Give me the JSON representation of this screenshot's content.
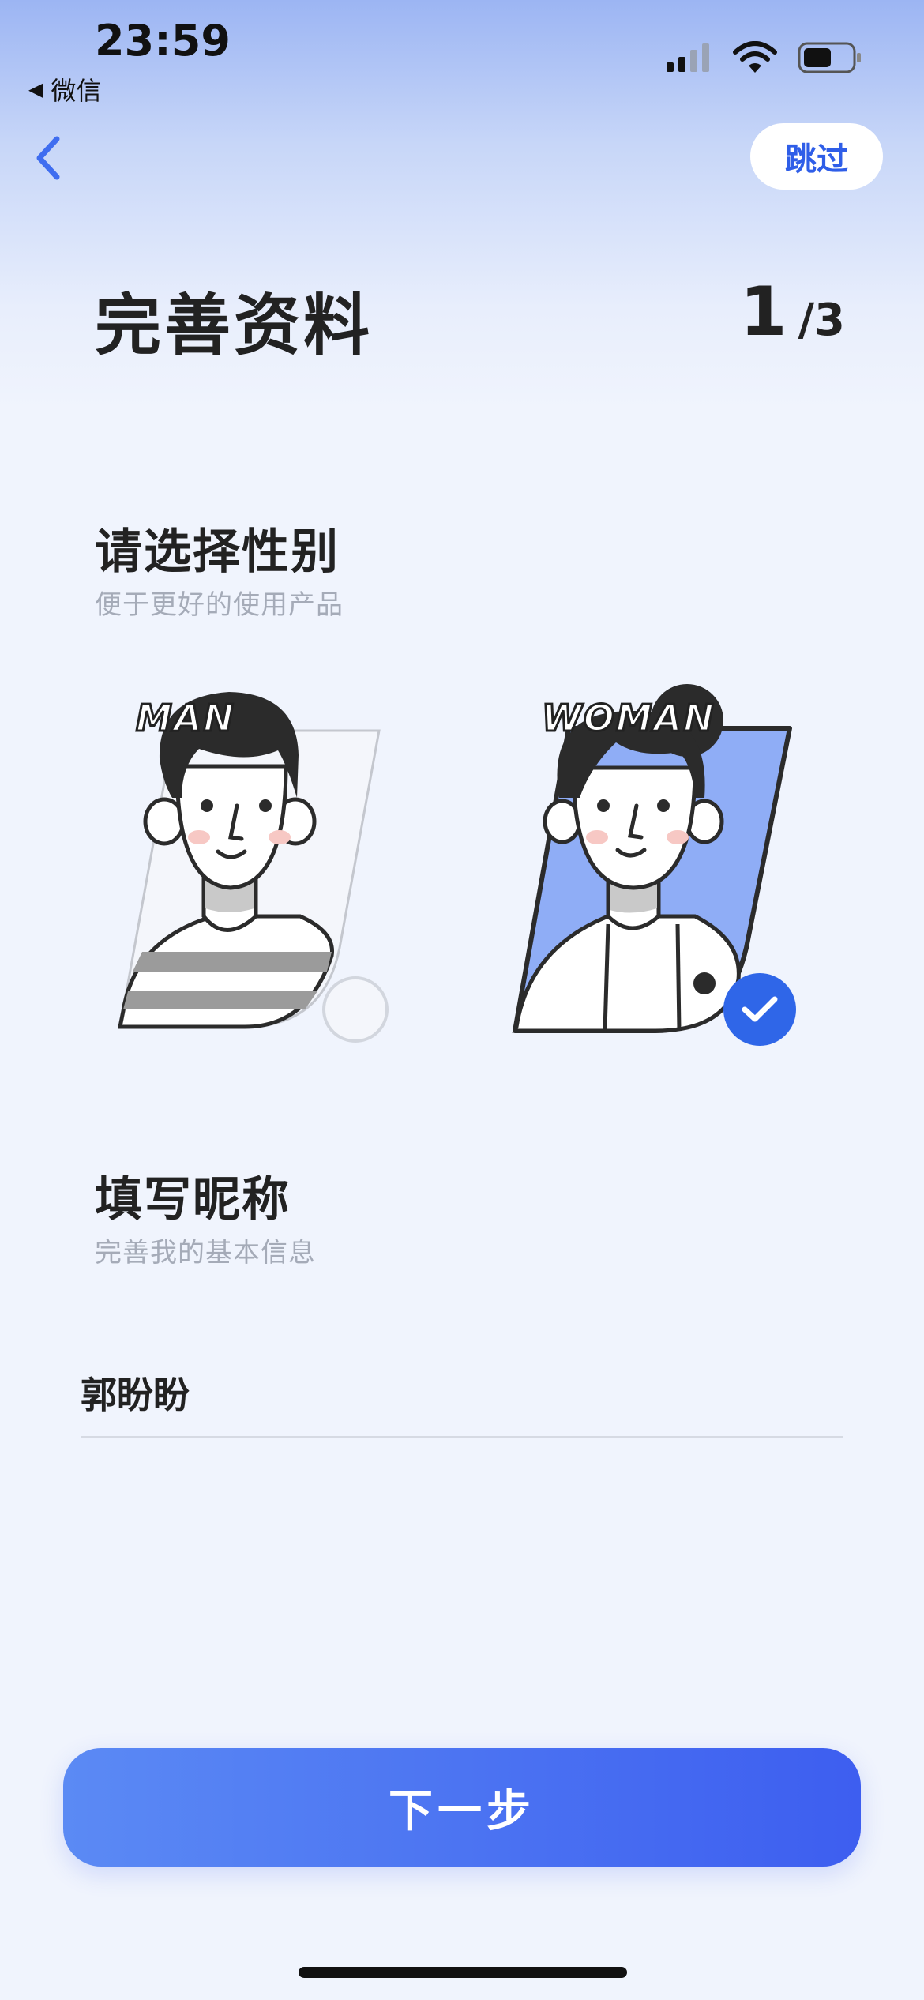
{
  "status_bar": {
    "time": "23:59",
    "back_app": "微信"
  },
  "nav": {
    "skip_label": "跳过"
  },
  "header": {
    "title": "完善资料",
    "step_current": "1",
    "step_total": "/3"
  },
  "gender_section": {
    "title": "请选择性别",
    "subtitle": "便于更好的使用产品",
    "options": [
      {
        "label": "MAN",
        "selected": false
      },
      {
        "label": "WOMAN",
        "selected": true
      }
    ]
  },
  "nickname_section": {
    "title": "填写昵称",
    "subtitle": "完善我的基本信息",
    "value": "郭盼盼"
  },
  "footer": {
    "next_label": "下一步"
  },
  "colors": {
    "accent": "#2f66e8",
    "button_start": "#5b8af4",
    "button_end": "#3d5ef0",
    "background": "#f0f4fd"
  }
}
